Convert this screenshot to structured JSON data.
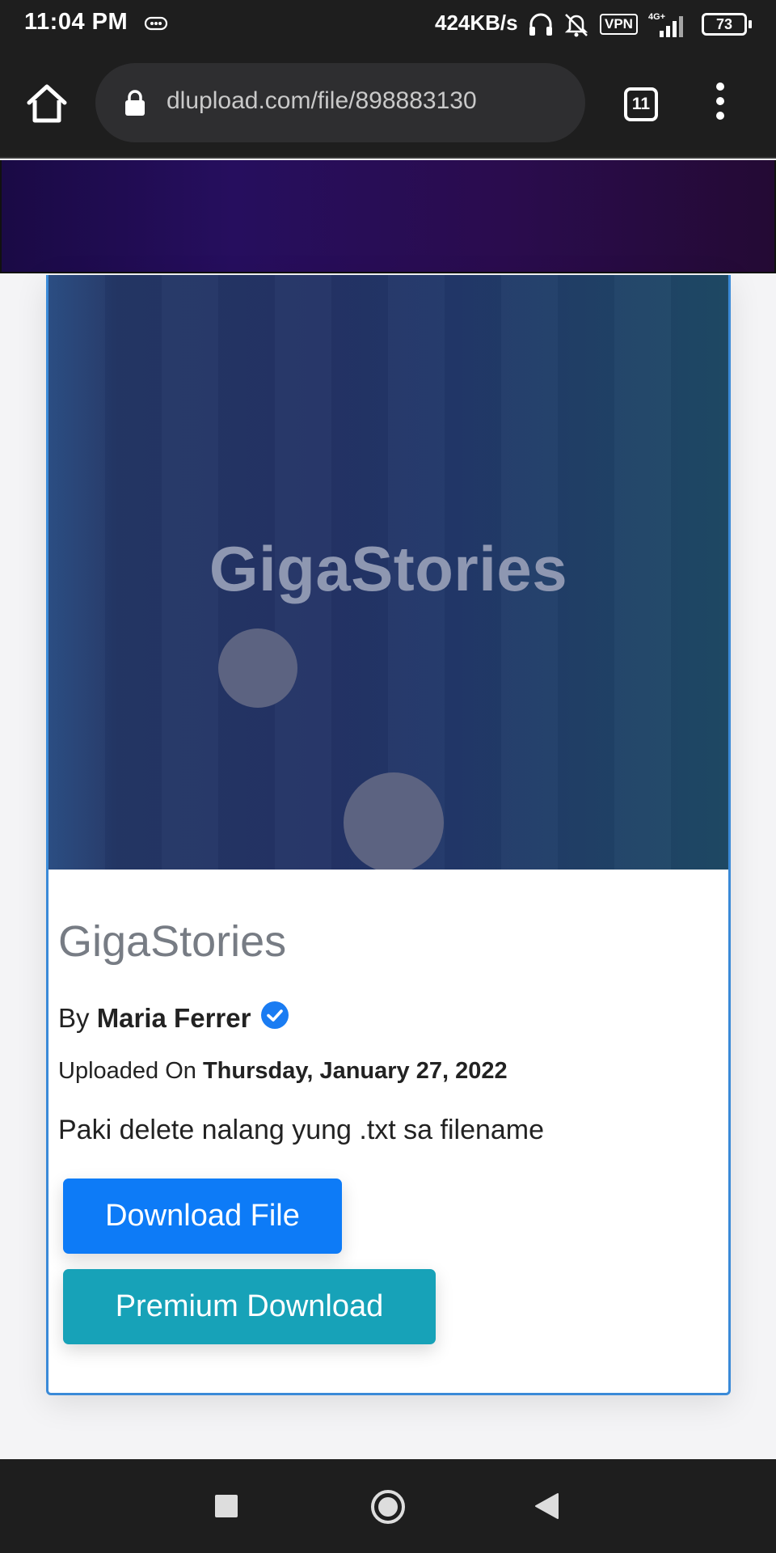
{
  "status_bar": {
    "time": "11:04 PM",
    "speed": "424KB/s",
    "vpn": "VPN",
    "network": "4G+",
    "battery": "73"
  },
  "browser": {
    "url": "dlupload.com/file/898883130",
    "tab_count": "11"
  },
  "hero": {
    "title": "GigaStories"
  },
  "file": {
    "title": "GigaStories",
    "by_prefix": "By",
    "author": "Maria Ferrer",
    "uploaded_prefix": "Uploaded On",
    "uploaded_date": "Thursday, January 27, 2022",
    "description": "Paki delete nalang yung .txt sa filename"
  },
  "actions": {
    "download_label": "Download File",
    "premium_label": "Premium Download"
  },
  "colors": {
    "download_button": "#0d7bf7",
    "premium_button": "#17a2b8",
    "card_border": "#3a8ad8",
    "verified_badge": "#1a7cf2"
  },
  "icons": [
    "home-icon",
    "lock-icon",
    "tabs-icon",
    "more-vert-icon",
    "verified-icon",
    "recents-icon",
    "home-circle-icon",
    "back-icon"
  ]
}
